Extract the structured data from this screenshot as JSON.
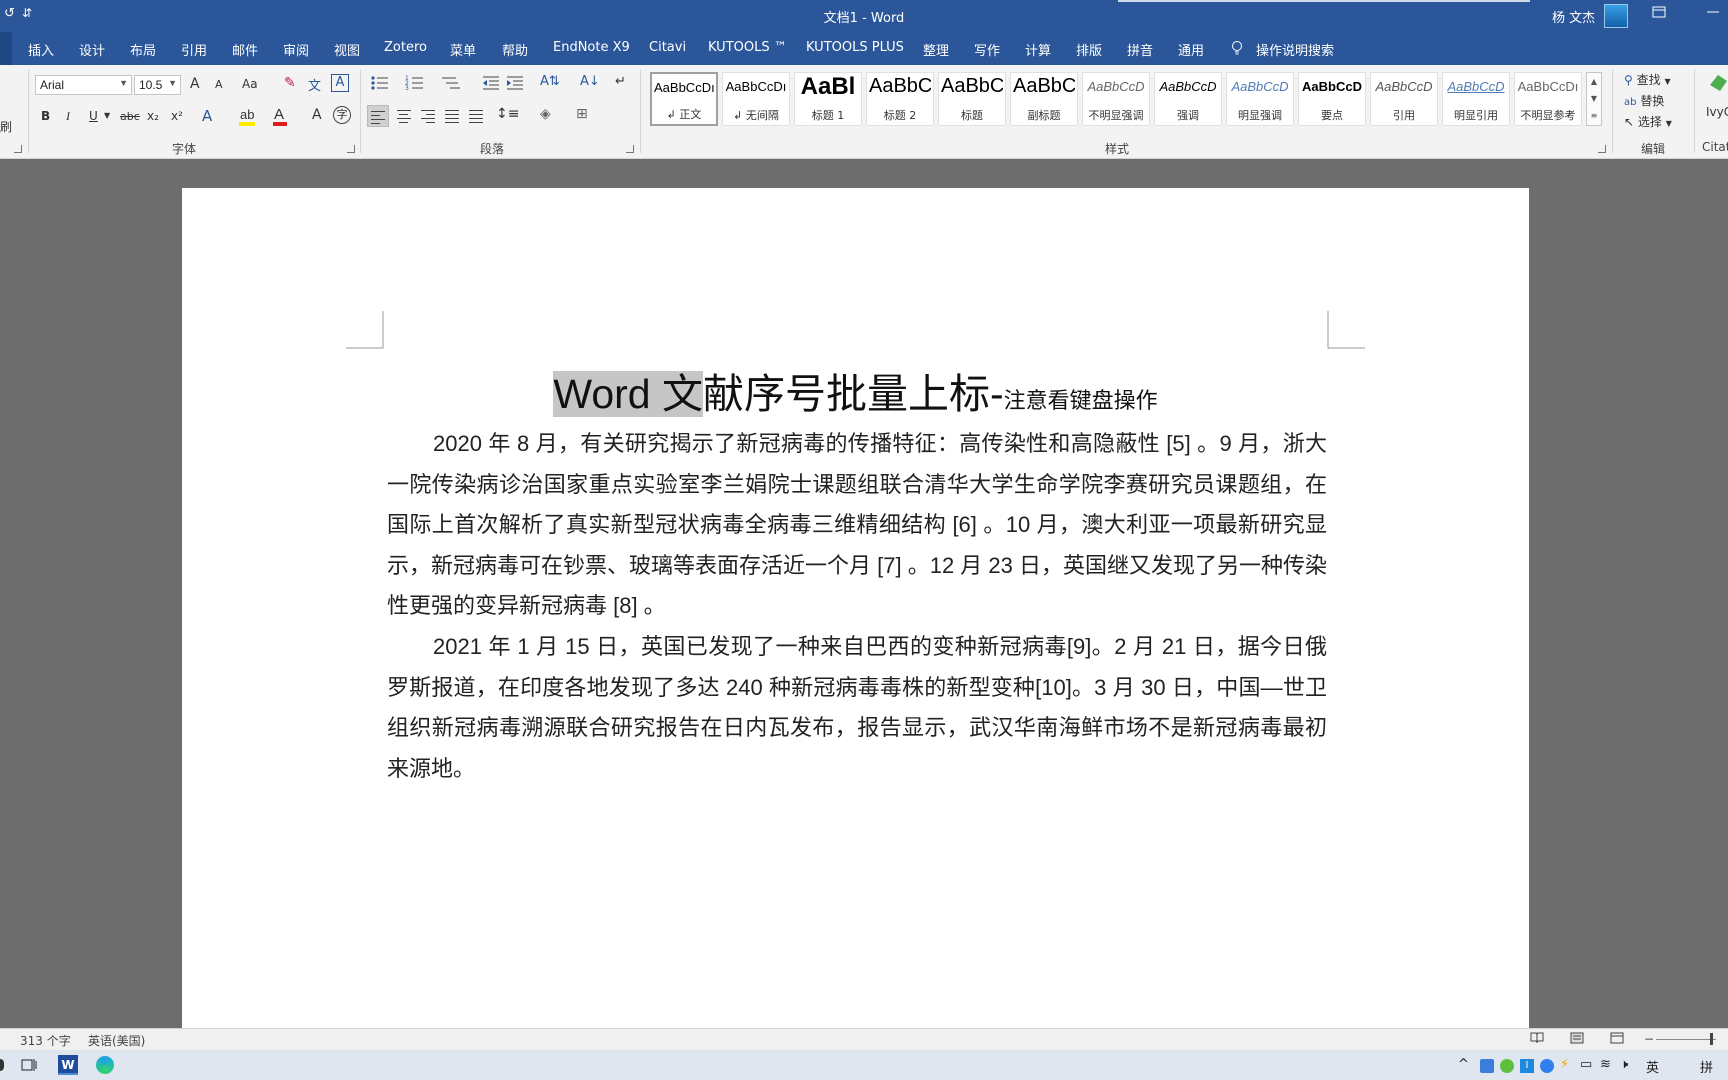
{
  "titlebar": {
    "title": "文档1  -  Word",
    "user": "杨 文杰",
    "quick_access": "↺",
    "customize": "⇵"
  },
  "tabs": [
    "插入",
    "设计",
    "布局",
    "引用",
    "邮件",
    "审阅",
    "视图",
    "Zotero",
    "菜单",
    "帮助",
    "EndNote X9",
    "Citavi",
    "KUTOOLS ™",
    "KUTOOLS PLUS",
    "整理",
    "写作",
    "计算",
    "排版",
    "拼音",
    "通用",
    "操作说明搜索"
  ],
  "ribbon": {
    "clipboard_label": "刷",
    "font": {
      "name": "Arial",
      "size": "10.5",
      "grow": "A",
      "shrink": "A",
      "case": "Aa",
      "bold": "B",
      "italic": "I",
      "underline": "U",
      "strike": "abc",
      "sub": "x₂",
      "sup": "x²",
      "group_label": "字体"
    },
    "paragraph": {
      "group_label": "段落"
    },
    "styles": {
      "group_label": "样式",
      "items": [
        {
          "sample": "AaBbCcDı",
          "name": "↲ 正文"
        },
        {
          "sample": "AaBbCcDı",
          "name": "↲ 无间隔"
        },
        {
          "sample": "AaBl",
          "name": "标题 1"
        },
        {
          "sample": "AaBbC",
          "name": "标题 2"
        },
        {
          "sample": "AaBbC",
          "name": "标题"
        },
        {
          "sample": "AaBbC",
          "name": "副标题"
        },
        {
          "sample": "AaBbCcD",
          "name": "不明显强调"
        },
        {
          "sample": "AaBbCcD",
          "name": "强调"
        },
        {
          "sample": "AaBbCcD",
          "name": "明显强调"
        },
        {
          "sample": "AaBbCcD",
          "name": "要点"
        },
        {
          "sample": "AaBbCcD",
          "name": "引用"
        },
        {
          "sample": "AaBbCcD",
          "name": "明显引用"
        },
        {
          "sample": "AaBbCcDı",
          "name": "不明显参考"
        }
      ]
    },
    "editing": {
      "find": "查找",
      "replace": "替换",
      "select": "选择",
      "group_label": "编辑"
    },
    "citavi": {
      "label": "IvyC",
      "group_label": "Citat"
    }
  },
  "document": {
    "title_selected": "Word 文",
    "title_rest": "献序号批量上标-",
    "title_small": "注意看键盘操作",
    "paragraphs": [
      "2020 年 8 月，有关研究揭示了新冠病毒的传播特征：高传染性和高隐蔽性 [5] 。9 月，浙大一院传染病诊治国家重点实验室李兰娟院士课题组联合清华大学生命学院李赛研究员课题组，在国际上首次解析了真实新型冠状病毒全病毒三维精细结构 [6] 。10 月，澳大利亚一项最新研究显示，新冠病毒可在钞票、玻璃等表面存活近一个月 [7] 。12 月 23 日，英国继又发现了另一种传染性更强的变异新冠病毒 [8] 。",
      "2021 年 1 月 15 日，英国已发现了一种来自巴西的变种新冠病毒[9]。2 月 21 日，据今日俄罗斯报道，在印度各地发现了多达 240 种新冠病毒毒株的新型变种[10]。3 月 30 日，中国—世卫组织新冠病毒溯源联合研究报告在日内瓦发布，报告显示，武汉华南海鲜市场不是新冠病毒最初来源地。"
    ]
  },
  "statusbar": {
    "word_count": "313 个字",
    "language": "英语(美国)"
  },
  "taskbar": {
    "ime": "英",
    "ime2": "拼"
  },
  "colors": {
    "accent": "#2b579a",
    "ribbon_bg": "#f3f3f3",
    "canvas_bg": "#6d6d6d",
    "selection": "#c6c6c6"
  }
}
